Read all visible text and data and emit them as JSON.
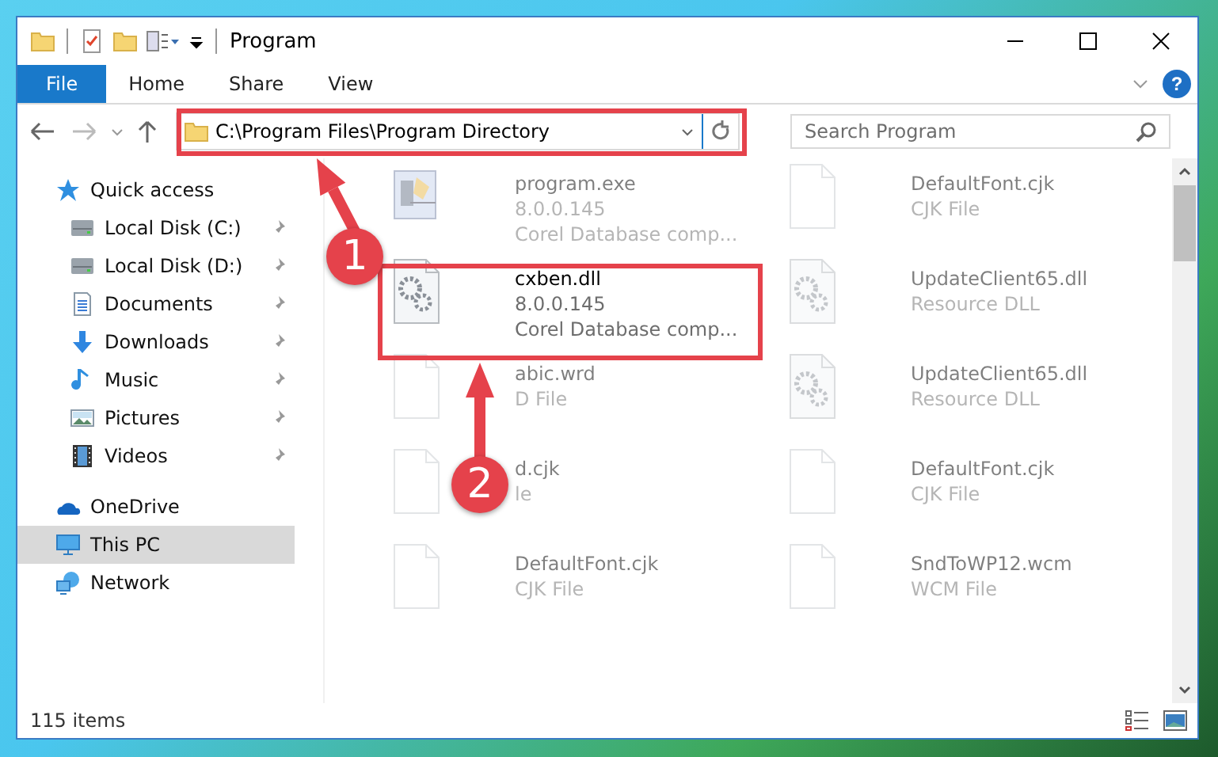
{
  "window": {
    "title": "Program"
  },
  "ribbon_tabs": [
    {
      "label": "File",
      "selected": true
    },
    {
      "label": "Home",
      "selected": false
    },
    {
      "label": "Share",
      "selected": false
    },
    {
      "label": "View",
      "selected": false
    }
  ],
  "address_bar": {
    "path": "C:\\Program Files\\Program Directory"
  },
  "search": {
    "placeholder": "Search Program"
  },
  "sidebar": {
    "items": [
      {
        "label": "Quick access",
        "kind": "star",
        "selected": false,
        "children": [
          {
            "label": "Local Disk (C:)",
            "kind": "drive",
            "pinned": true,
            "selected": false
          },
          {
            "label": "Local Disk (D:)",
            "kind": "drive",
            "pinned": true,
            "selected": false
          },
          {
            "label": "Documents",
            "kind": "documents",
            "pinned": true,
            "selected": false
          },
          {
            "label": "Downloads",
            "kind": "downloads",
            "pinned": true,
            "selected": false
          },
          {
            "label": "Music",
            "kind": "music",
            "pinned": true,
            "selected": false
          },
          {
            "label": "Pictures",
            "kind": "pictures",
            "pinned": true,
            "selected": false
          },
          {
            "label": "Videos",
            "kind": "videos",
            "pinned": true,
            "selected": false
          }
        ]
      },
      {
        "label": "OneDrive",
        "kind": "cloud",
        "selected": false
      },
      {
        "label": "This PC",
        "kind": "pc",
        "selected": true
      },
      {
        "label": "Network",
        "kind": "network",
        "selected": false
      }
    ]
  },
  "files": [
    {
      "name": "program.exe",
      "details": [
        "8.0.0.145",
        "Corel Database comp..."
      ],
      "kind": "app",
      "dimmed": true
    },
    {
      "name": "DefaultFont.cjk",
      "details": [
        "CJK File"
      ],
      "kind": "blank",
      "dimmed": true
    },
    {
      "name": "cxben.dll",
      "details": [
        "8.0.0.145",
        "Corel Database comp..."
      ],
      "kind": "gear",
      "dimmed": false
    },
    {
      "name": "UpdateClient65.dll",
      "details": [
        "Resource DLL"
      ],
      "kind": "gear",
      "dimmed": true
    },
    {
      "name": "abic.wrd",
      "details": [
        "D File"
      ],
      "kind": "blank",
      "dimmed": true
    },
    {
      "name": "UpdateClient65.dll",
      "details": [
        "Resource DLL"
      ],
      "kind": "gear",
      "dimmed": true
    },
    {
      "name": "d.cjk",
      "details": [
        "le"
      ],
      "kind": "blank",
      "dimmed": true
    },
    {
      "name": "DefaultFont.cjk",
      "details": [
        "CJK File"
      ],
      "kind": "blank",
      "dimmed": true
    },
    {
      "name": "DefaultFont.cjk",
      "details": [
        "CJK File"
      ],
      "kind": "blank",
      "dimmed": true
    },
    {
      "name": "SndToWP12.wcm",
      "details": [
        "WCM File"
      ],
      "kind": "blank",
      "dimmed": true
    }
  ],
  "status_bar": {
    "item_count": "115 items"
  },
  "help_button": "?",
  "annotations": [
    {
      "label": "1",
      "kind": "address"
    },
    {
      "label": "2",
      "kind": "file"
    }
  ]
}
